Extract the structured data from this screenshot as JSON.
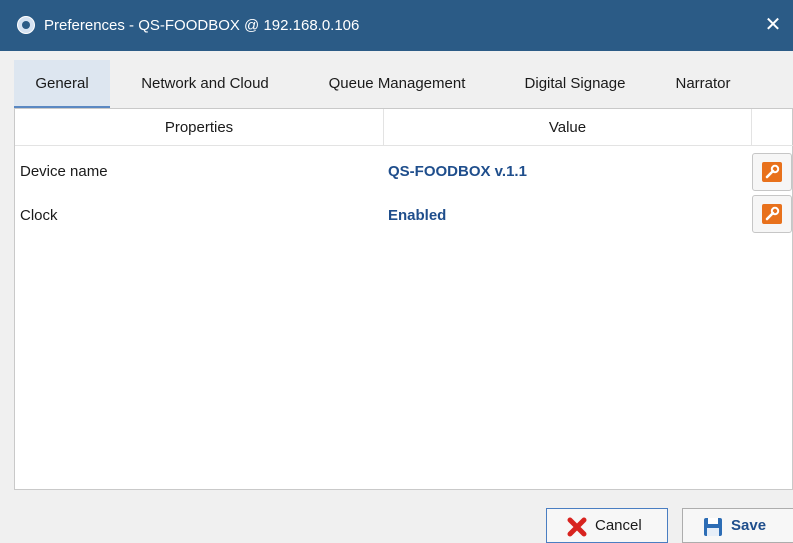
{
  "window": {
    "title": "Preferences - QS-FOODBOX @ 192.168.0.106",
    "close_glyph": "✕",
    "app_icon": "app-logo-icon"
  },
  "tabs": [
    {
      "label": "General",
      "active": true
    },
    {
      "label": "Network and Cloud",
      "active": false
    },
    {
      "label": "Queue Management",
      "active": false
    },
    {
      "label": "Digital Signage",
      "active": false
    },
    {
      "label": "Narrator",
      "active": false
    }
  ],
  "table": {
    "columns": [
      "Properties",
      "Value"
    ],
    "rows": [
      {
        "property": "Device name",
        "value": "QS-FOODBOX v.1.1",
        "action_icon": "wrench-icon"
      },
      {
        "property": "Clock",
        "value": "Enabled",
        "action_icon": "wrench-icon"
      }
    ]
  },
  "footer": {
    "cancel_label": "Cancel",
    "save_label": "Save",
    "cancel_icon": "red-x-icon",
    "save_icon": "floppy-disk-icon"
  },
  "colors": {
    "titlebar": "#2b5b86",
    "value_text": "#1f4e8c",
    "wrench_bg": "#e8711c",
    "cancel_x": "#d8231f"
  }
}
